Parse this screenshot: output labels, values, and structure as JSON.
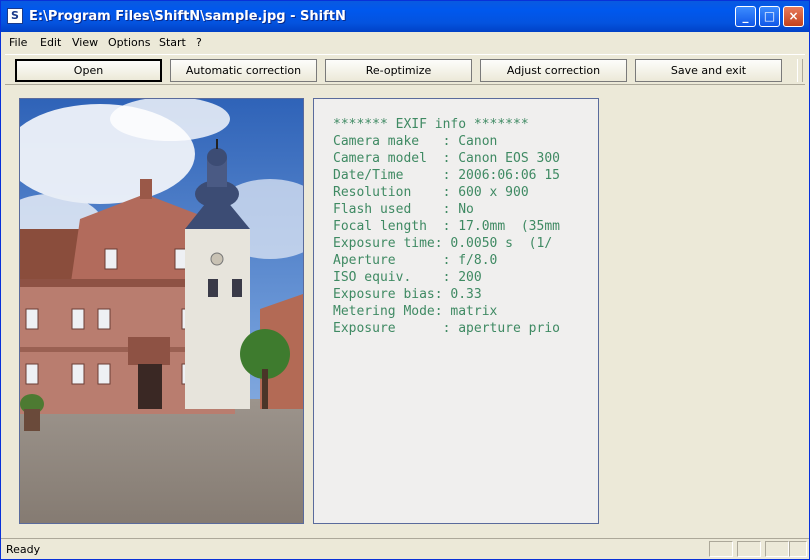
{
  "window": {
    "title": "E:\\Program Files\\ShiftN\\sample.jpg - ShiftN",
    "app_icon_letter": "S",
    "minimize_glyph": "_",
    "maximize_glyph": "□",
    "close_glyph": "×"
  },
  "menu": [
    "File",
    "Edit",
    "View",
    "Options",
    "Start",
    "?"
  ],
  "toolbar": {
    "buttons": [
      "Open",
      "Automatic correction",
      "Re-optimize",
      "Adjust correction",
      "Save and exit"
    ],
    "default_button": "Open"
  },
  "exif": {
    "title": "******* EXIF info *******",
    "rows": [
      "Camera make   : Canon",
      "Camera model  : Canon EOS 300",
      "Date/Time     : 2006:06:06 15",
      "Resolution    : 600 x 900",
      "Flash used    : No",
      "Focal length  : 17.0mm  (35mm",
      "Exposure time: 0.0050 s  (1/",
      "Aperture      : f/8.0",
      "ISO equiv.    : 200",
      "Exposure bias: 0.33",
      "Metering Mode: matrix",
      "Exposure      : aperture prio"
    ],
    "text_color": "#3f8a63"
  },
  "status": {
    "text": "Ready"
  },
  "colors": {
    "titlebar": "#0058ee",
    "window_bg": "#ece9d8",
    "panel_border": "#5a6b9c"
  }
}
